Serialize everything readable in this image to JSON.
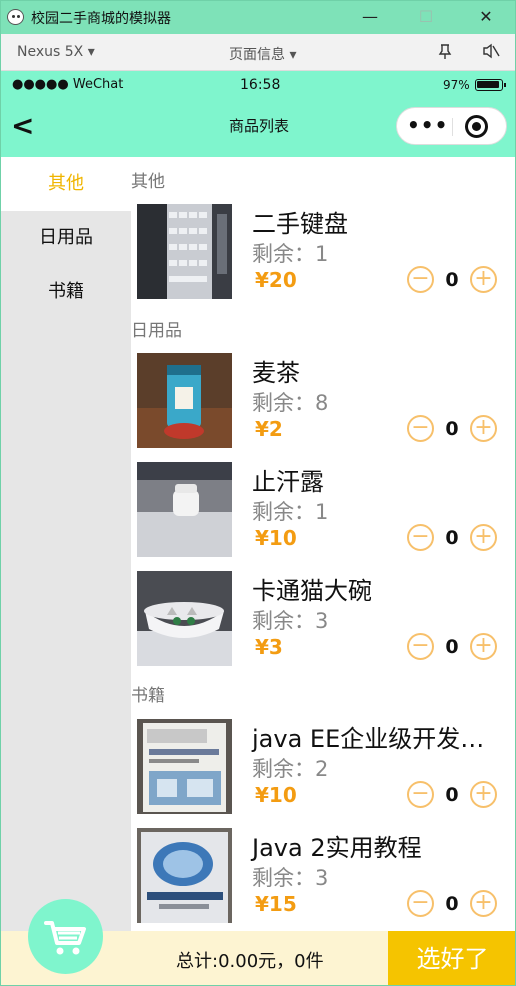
{
  "window": {
    "title": "校园二手商城的模拟器",
    "min": "—",
    "max": "☐",
    "close": "✕"
  },
  "simulator": {
    "device": "Nexus 5X ▾",
    "page_info": "页面信息 ▾"
  },
  "status": {
    "carrier": "●●●●● WeChat",
    "time": "16:58",
    "battery": "97%"
  },
  "nav": {
    "back": "<",
    "title": "商品列表",
    "more": "•••"
  },
  "categories": [
    {
      "label": "其他",
      "active": true
    },
    {
      "label": "日用品",
      "active": false
    },
    {
      "label": "书籍",
      "active": false
    }
  ],
  "sections": [
    {
      "title": "其他",
      "items": [
        {
          "name": "二手键盘",
          "stock_label": "剩余：",
          "stock": "1",
          "price": "¥20",
          "qty": "0"
        }
      ]
    },
    {
      "title": "日用品",
      "items": [
        {
          "name": "麦茶",
          "stock_label": "剩余：",
          "stock": "8",
          "price": "¥2",
          "qty": "0"
        },
        {
          "name": "止汗露",
          "stock_label": "剩余：",
          "stock": "1",
          "price": "¥10",
          "qty": "0"
        },
        {
          "name": "卡通猫大碗",
          "stock_label": "剩余：",
          "stock": "3",
          "price": "¥3",
          "qty": "0"
        }
      ]
    },
    {
      "title": "书籍",
      "items": [
        {
          "name": "java EE企业级开发…",
          "stock_label": "剩余：",
          "stock": "2",
          "price": "¥10",
          "qty": "0"
        },
        {
          "name": "Java 2实用教程",
          "stock_label": "剩余：",
          "stock": "3",
          "price": "¥15",
          "qty": "0"
        }
      ]
    }
  ],
  "controls": {
    "minus": "−",
    "plus": "+"
  },
  "cart": {
    "total": "总计:0.00元，0件",
    "done": "选好了"
  },
  "colors": {
    "accent": "#f5c400",
    "nav_bg": "#7ff5cd",
    "price": "#f39c12"
  }
}
